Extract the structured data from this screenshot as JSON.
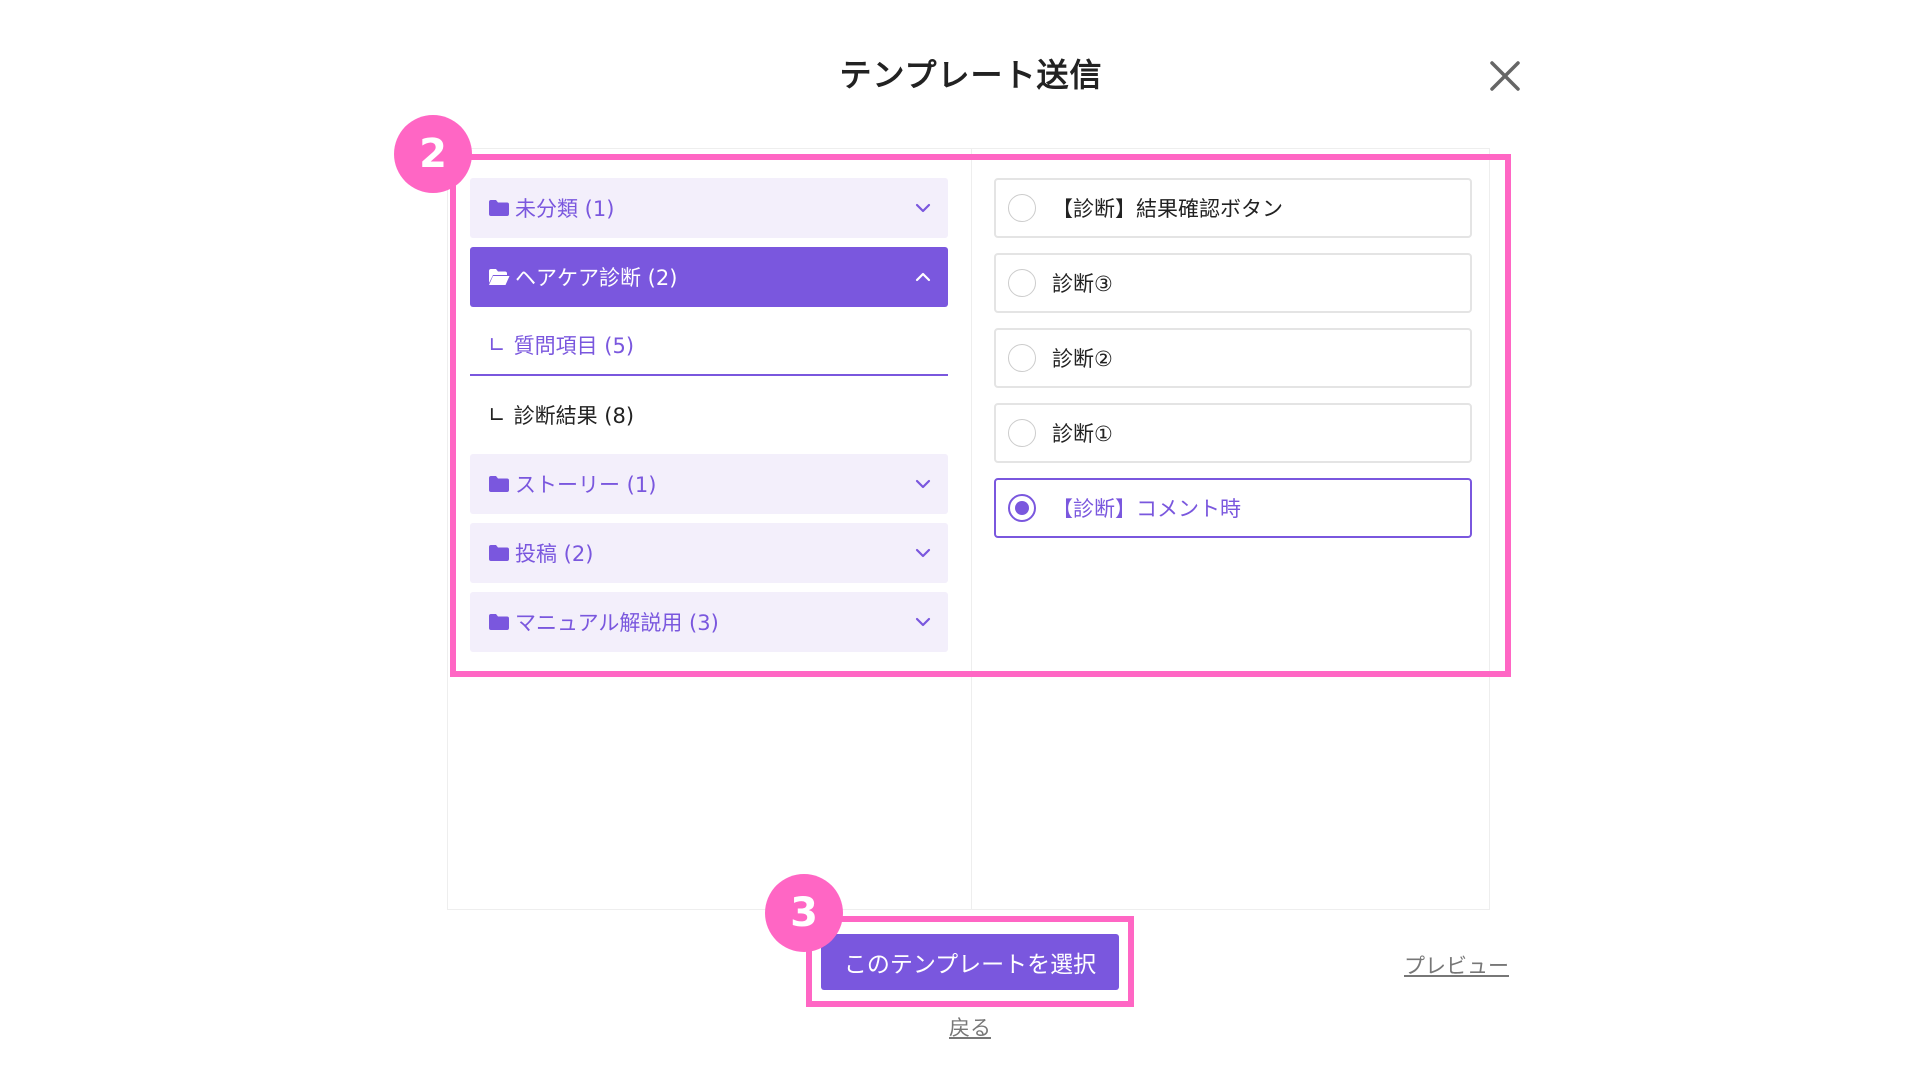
{
  "modal": {
    "title": "テンプレート送信",
    "close_icon": "close-icon"
  },
  "folders": {
    "items": [
      {
        "label": "未分類 (1)",
        "icon": "folder-icon",
        "state": "collapsed"
      },
      {
        "label": "ヘアケア診断 (2)",
        "icon": "folder-open-icon",
        "state": "expanded"
      },
      {
        "label": "ストーリー (1)",
        "icon": "folder-icon",
        "state": "collapsed"
      },
      {
        "label": "投稿 (2)",
        "icon": "folder-icon",
        "state": "collapsed"
      },
      {
        "label": "マニュアル解説用 (3)",
        "icon": "folder-icon",
        "state": "collapsed"
      }
    ],
    "subfolders": [
      {
        "prefix": "∟",
        "label": "質問項目 (5)",
        "active": true
      },
      {
        "prefix": "∟",
        "label": "診断結果 (8)",
        "active": false
      }
    ]
  },
  "templates": {
    "items": [
      {
        "label": "【診断】結果確認ボタン",
        "selected": false
      },
      {
        "label": "診断③",
        "selected": false
      },
      {
        "label": "診断②",
        "selected": false
      },
      {
        "label": "診断①",
        "selected": false
      },
      {
        "label": "【診断】コメント時",
        "selected": true
      }
    ]
  },
  "actions": {
    "select_label": "このテンプレートを選択",
    "preview_label": "プレビュー",
    "back_label": "戻る"
  },
  "annotations": {
    "step2": "2",
    "step3": "3"
  },
  "colors": {
    "accent": "#7a57de",
    "accent_light": "#f3effb",
    "highlight": "#ff66c4"
  }
}
